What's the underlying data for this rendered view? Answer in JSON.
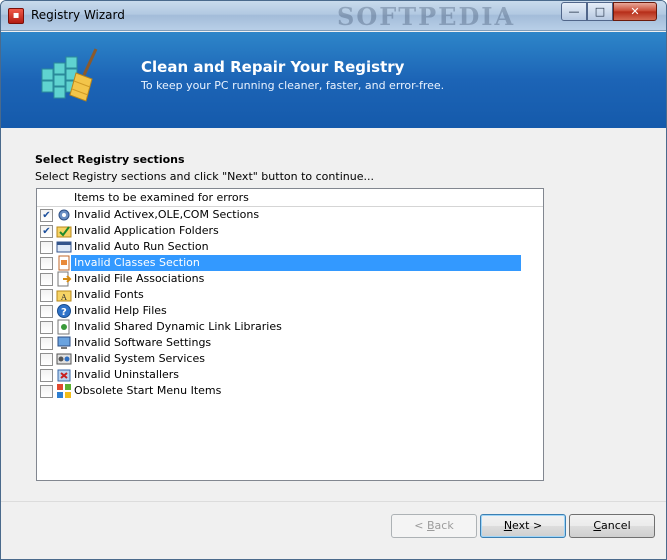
{
  "window": {
    "title": "Registry Wizard",
    "watermark": "SOFTPEDIA",
    "controls": {
      "minimize": "—",
      "maximize": "□",
      "close": "✕"
    }
  },
  "header": {
    "title": "Clean and Repair Your Registry",
    "subtitle": "To keep your PC running cleaner, faster, and error-free."
  },
  "section": {
    "title": "Select Registry sections",
    "instruction": "Select Registry sections and click \"Next\" button to continue..."
  },
  "list": {
    "column_header": "Items to be examined for errors",
    "items": [
      {
        "label": "Invalid Activex,OLE,COM Sections",
        "checked": true,
        "icon": "gear-icon"
      },
      {
        "label": "Invalid Application Folders",
        "checked": true,
        "icon": "folder-check-icon"
      },
      {
        "label": "Invalid Auto Run Section",
        "checked": false,
        "icon": "window-icon"
      },
      {
        "label": "Invalid Classes Section",
        "checked": false,
        "icon": "document-icon",
        "selected": true
      },
      {
        "label": "Invalid File Associations",
        "checked": false,
        "icon": "file-arrow-icon"
      },
      {
        "label": "Invalid Fonts",
        "checked": false,
        "icon": "font-folder-icon"
      },
      {
        "label": "Invalid Help Files",
        "checked": false,
        "icon": "help-icon"
      },
      {
        "label": "Invalid Shared Dynamic Link Libraries",
        "checked": false,
        "icon": "library-icon"
      },
      {
        "label": "Invalid Software Settings",
        "checked": false,
        "icon": "software-icon"
      },
      {
        "label": "Invalid System Services",
        "checked": false,
        "icon": "services-icon"
      },
      {
        "label": "Invalid Uninstallers",
        "checked": false,
        "icon": "uninstall-icon"
      },
      {
        "label": "Obsolete Start Menu Items",
        "checked": false,
        "icon": "start-menu-icon"
      }
    ]
  },
  "buttons": {
    "back": {
      "accel": "B",
      "rest": "ack",
      "prefix": "< "
    },
    "next": {
      "accel": "N",
      "rest": "ext >"
    },
    "cancel": {
      "accel": "C",
      "rest": "ancel"
    }
  },
  "colors": {
    "banner": "#1c64b6",
    "selection": "#3399ff"
  }
}
